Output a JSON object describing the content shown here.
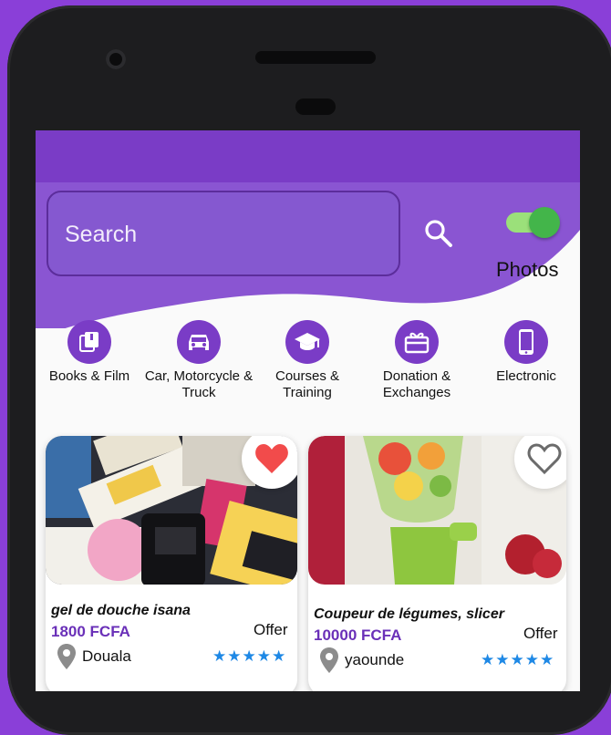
{
  "search": {
    "placeholder": "Search"
  },
  "toggle": {
    "label": "Photos",
    "on": true
  },
  "categories": [
    {
      "label": "Books & Film",
      "icon": "book-icon"
    },
    {
      "label": "Car, Motorcycle & Truck",
      "icon": "car-icon"
    },
    {
      "label": "Courses & Training",
      "icon": "graduation-cap-icon"
    },
    {
      "label": "Donation & Exchanges",
      "icon": "gift-icon"
    },
    {
      "label": "Electronic",
      "icon": "smartphone-icon"
    }
  ],
  "listings": [
    {
      "title": "gel de douche isana",
      "price": "1800 FCFA",
      "type": "Offer",
      "location": "Douala",
      "rating": 5,
      "stars": "★★★★★",
      "favorite": true
    },
    {
      "title": "Coupeur de légumes, slicer",
      "price": "10000 FCFA",
      "type": "Offer",
      "location": "yaounde",
      "rating": 5,
      "stars": "★★★★★",
      "favorite": false
    }
  ],
  "colors": {
    "primary": "#7a3cc6",
    "accent_star": "#1e88e5",
    "favorite": "#f24b4b",
    "toggle": "#43b54a"
  }
}
